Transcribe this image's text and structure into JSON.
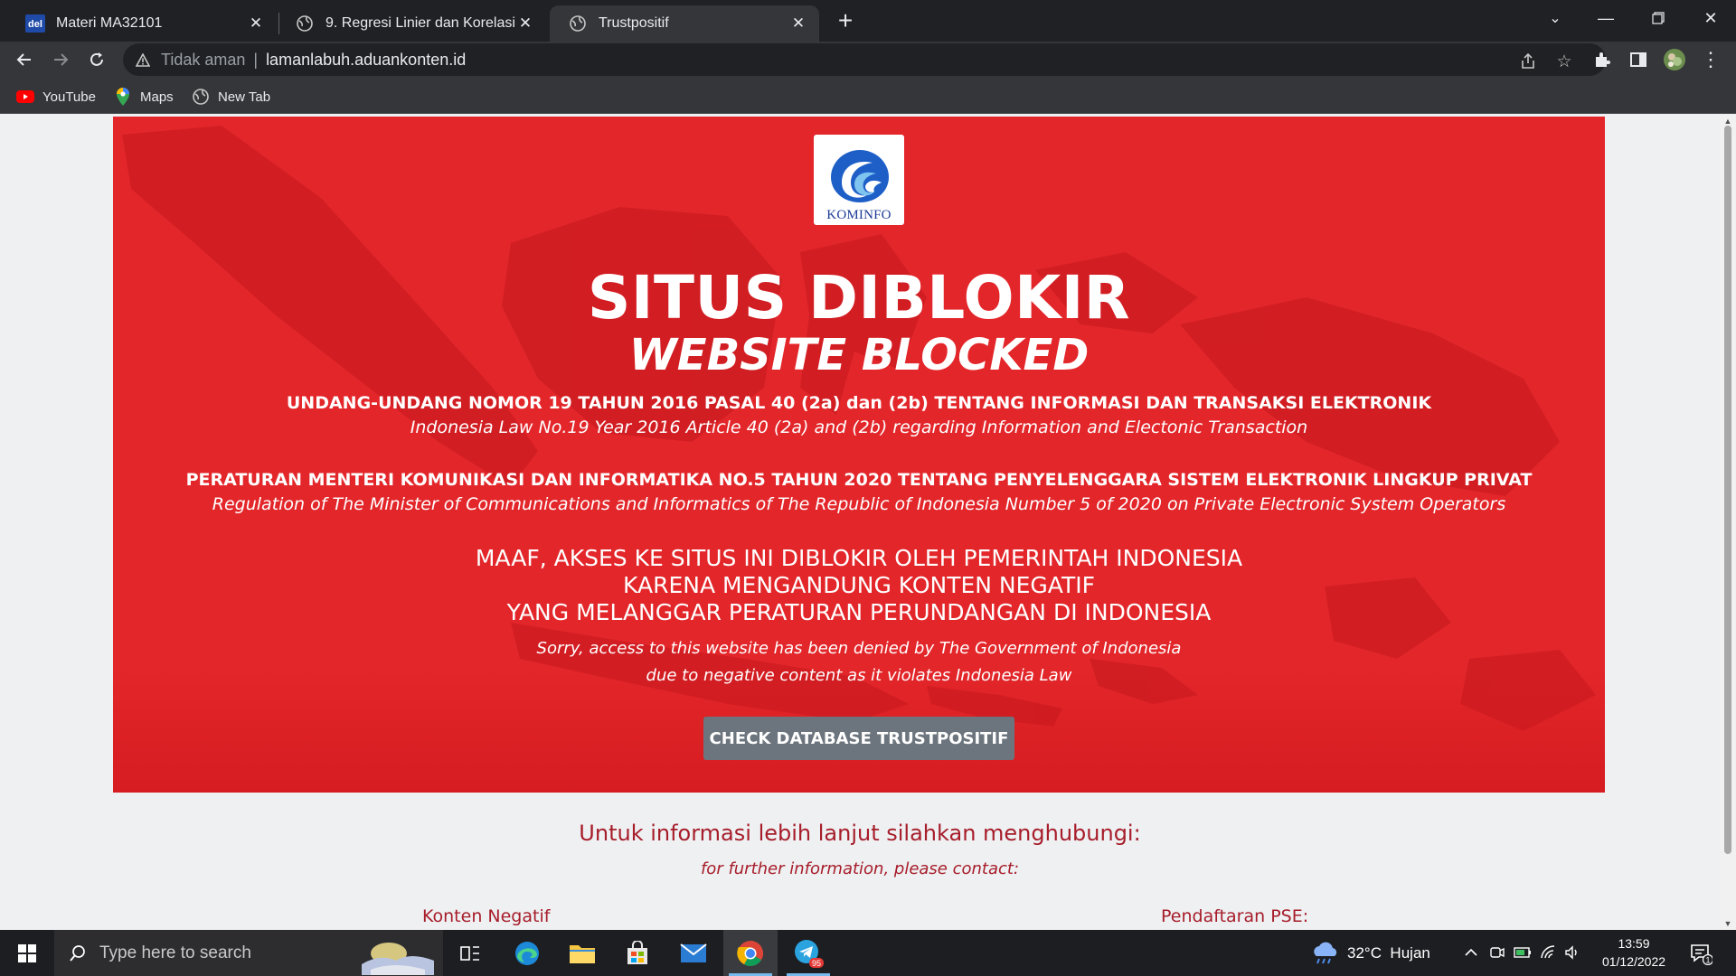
{
  "browser": {
    "tabs": [
      {
        "title": "Materi MA32101",
        "favicon": "del-icon"
      },
      {
        "title": "9. Regresi Linier dan Korelasi",
        "favicon": "globe-icon"
      },
      {
        "title": "Trustpositif",
        "favicon": "globe-icon",
        "active": true
      }
    ],
    "omnibox": {
      "security_label": "Tidak aman",
      "url": "lamanlabuh.aduankonten.id"
    },
    "bookmarks": [
      {
        "label": "YouTube",
        "icon": "youtube-icon"
      },
      {
        "label": "Maps",
        "icon": "maps-icon"
      },
      {
        "label": "New Tab",
        "icon": "globe-icon"
      }
    ]
  },
  "page": {
    "logo_text": "KOMINFO",
    "heading": "SITUS DIBLOKIR",
    "subheading": "WEBSITE BLOCKED",
    "law1": "UNDANG-UNDANG NOMOR 19 TAHUN 2016 PASAL 40 (2a) dan (2b) TENTANG INFORMASI DAN TRANSAKSI ELEKTRONIK",
    "law1_en": "Indonesia Law No.19 Year 2016 Article 40 (2a) and (2b) regarding Information and Electonic Transaction",
    "law2": "PERATURAN MENTERI KOMUNIKASI DAN INFORMATIKA NO.5 TAHUN 2020 TENTANG PENYELENGGARA SISTEM ELEKTRONIK LINGKUP PRIVAT",
    "law2_en": "Regulation of The Minister of Communications and Informatics of The Republic of Indonesia Number 5 of 2020 on Private Electronic System Operators",
    "sorry_lines": [
      "MAAF, AKSES KE SITUS INI DIBLOKIR OLEH PEMERINTAH INDONESIA",
      "KARENA MENGANDUNG KONTEN NEGATIF",
      "YANG MELANGGAR PERATURAN PERUNDANGAN DI INDONESIA"
    ],
    "sorry_en_lines": [
      "Sorry, access to this website has been denied by The Government of Indonesia",
      "due to negative content as it violates Indonesia Law"
    ],
    "check_button": "CHECK DATABASE TRUSTPOSITIF",
    "info_title": "Untuk informasi lebih lanjut silahkan menghubungi:",
    "info_subtitle": "for further information, please contact:",
    "contact_left": "Konten Negatif",
    "contact_right": "Pendaftaran PSE:",
    "colors": {
      "banner": "#e3262a",
      "accent": "#a71d2a",
      "button": "#6c757d"
    }
  },
  "taskbar": {
    "search_placeholder": "Type here to search",
    "weather": "32°C  Hujan",
    "time": "13:59",
    "date": "01/12/2022",
    "notification_count": "1",
    "telegram_badge": "95"
  }
}
